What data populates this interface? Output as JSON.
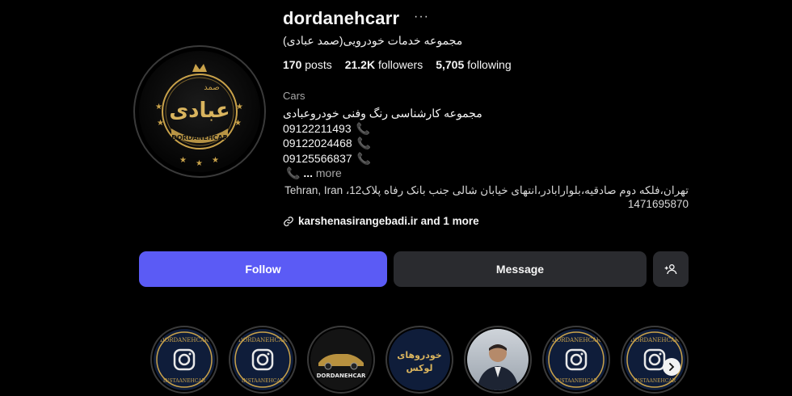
{
  "profile": {
    "username": "dordanehcarr",
    "more_options": "···",
    "full_name": "مجموعه خدمات خودرویی(صمد عبادی)",
    "stats": {
      "posts_count": "170",
      "posts_label": "posts",
      "followers_count": "21.2K",
      "followers_label": "followers",
      "following_count": "5,705",
      "following_label": "following"
    },
    "category": "Cars",
    "bio": {
      "line1": "مجموعه کارشناسی رنگ وفنی خودروعبادی",
      "phone1": "09122211493",
      "phone2": "09122024468",
      "phone3": "09125566837",
      "ellipsis": "...",
      "more": "more",
      "address": "تهران،فلکه دوم صادقیه،بلوارابادر،انتهای خیابان شالی جنب بانک رفاه پلاک12، Tehran, Iran 1471695870"
    },
    "link": {
      "text": "karshenasirangebadi.ir and 1 more",
      "icon": "link-icon"
    },
    "avatar": {
      "logo_text_top": "صمد",
      "logo_text_main": "عبادی",
      "logo_text_bottom": "DORDANEHCAR"
    }
  },
  "actions": {
    "follow_label": "Follow",
    "message_label": "Message",
    "add_user_icon": "add-user-icon"
  },
  "highlights": [
    {
      "kind": "instagram-badge",
      "ring_top": "DORDANEHCAR",
      "ring_bottom": "INSTAANEHCAR"
    },
    {
      "kind": "instagram-badge",
      "ring_top": "DORDANEHCAR",
      "ring_bottom": "INSTAANEHCAR"
    },
    {
      "kind": "car",
      "caption": "DORDANEHCAR"
    },
    {
      "kind": "text",
      "line1": "خودروهای",
      "line2": "لوکس"
    },
    {
      "kind": "person"
    },
    {
      "kind": "instagram-badge",
      "ring_top": "DORDANEHCAR",
      "ring_bottom": "INSTAANEHCAR"
    },
    {
      "kind": "instagram-badge",
      "ring_top": "DORDANEHCAR",
      "ring_bottom": "INSTAANEHCAR"
    }
  ],
  "colors": {
    "background": "#000000",
    "follow_button": "#5b5bf5",
    "secondary_button": "#2a2b2f",
    "phone_icon": "#e0457a",
    "gold": "#c9a24a",
    "badge_navy": "#0f1d3a"
  }
}
